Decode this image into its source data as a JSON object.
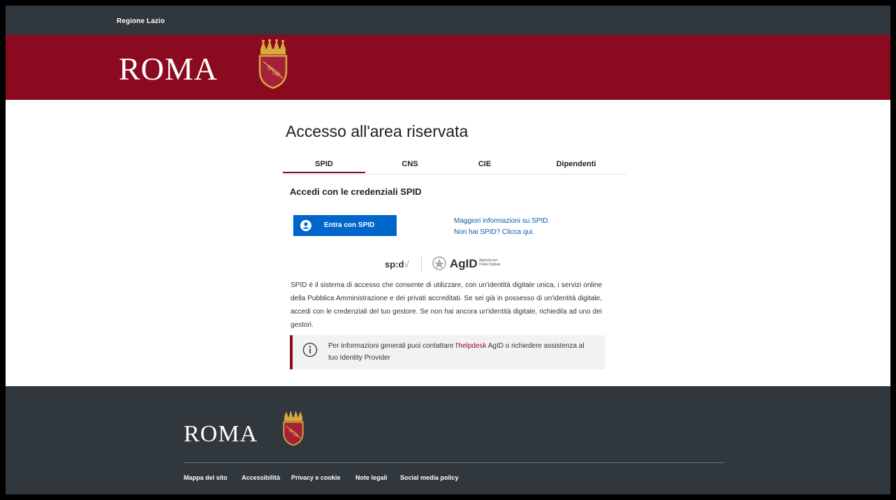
{
  "topbar": {
    "region": "Regione Lazio"
  },
  "header": {
    "logo_text": "ROMA",
    "crest_letters": "SPQR"
  },
  "main": {
    "title": "Accesso all'area riservata",
    "tabs": [
      {
        "label": "SPID",
        "active": true
      },
      {
        "label": "CNS",
        "active": false
      },
      {
        "label": "CIE",
        "active": false
      },
      {
        "label": "Dipendenti",
        "active": false
      }
    ],
    "subtitle": "Accedi con le credenziali SPID",
    "spid_button": "Entra con SPID",
    "info_link": "Maggiori informazioni su SPID.",
    "signup_link": "Non hai SPID? Clicca qui.",
    "logos": {
      "spid": "sp:d",
      "agid": "AgID",
      "agid_sub1": "Agenzia per",
      "agid_sub2": "l'Italia Digitale"
    },
    "description": "SPID è il sistema di accesso che consente di utilizzare, con un'identità digitale unica, i servizi online della Pubblica Amministrazione e dei privati accreditati. Se sei già in possesso di un'identità digitale, accedi con le credenziali del tuo gestore. Se non hai ancora un'identità digitale, richiedila ad uno dei gestori.",
    "notice": {
      "text_before": "Per informazioni generali puoi contattare l'",
      "link": "helpdesk",
      "text_after": " AgID o richiedere assistenza al tuo Identity Provider"
    }
  },
  "footer": {
    "logo_text": "ROMA",
    "links": [
      "Mappa del sito",
      "Accessibilità",
      "Privacy e cookie",
      "Note legali",
      "Social media policy"
    ]
  },
  "colors": {
    "brand_red": "#8b0a1f",
    "dark_bar": "#30373d",
    "spid_blue": "#0066cc",
    "link_blue": "#0a5da8"
  }
}
